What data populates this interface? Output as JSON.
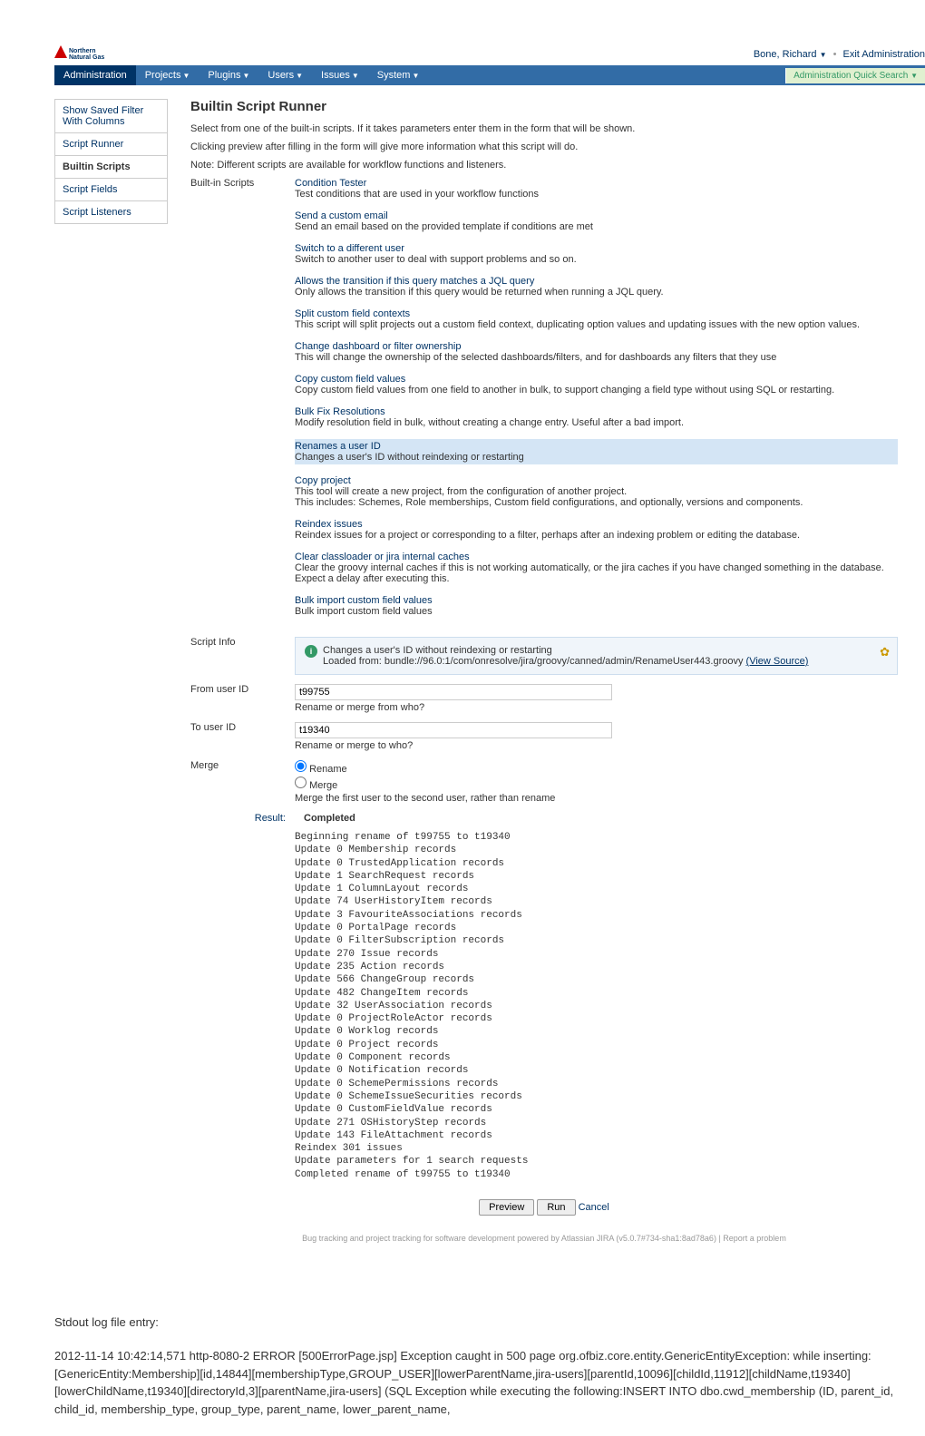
{
  "logo": {
    "line1": "Northern",
    "line2": "Natural Gas"
  },
  "user": {
    "name": "Bone, Richard",
    "exit": "Exit Administration"
  },
  "nav": {
    "items": [
      {
        "label": "Administration",
        "dd": false
      },
      {
        "label": "Projects",
        "dd": true
      },
      {
        "label": "Plugins",
        "dd": true
      },
      {
        "label": "Users",
        "dd": true
      },
      {
        "label": "Issues",
        "dd": true
      },
      {
        "label": "System",
        "dd": true
      }
    ],
    "search_placeholder": "Administration Quick Search"
  },
  "sidebar": {
    "items": [
      "Show Saved Filter With Columns",
      "Script Runner",
      "Builtin Scripts",
      "Script Fields",
      "Script Listeners"
    ]
  },
  "content": {
    "title": "Builtin Script Runner",
    "intro1": "Select from one of the built-in scripts. If it takes parameters enter them in the form that will be shown.",
    "intro2": "Clicking preview after filling in the form will give more information what this script will do.",
    "intro3": "Note: Different scripts are available for workflow functions and listeners.",
    "scripts_label": "Built-in Scripts",
    "scripts": [
      {
        "title": "Condition Tester",
        "desc": "Test conditions that are used in your workflow functions"
      },
      {
        "title": "Send a custom email",
        "desc": "Send an email based on the provided template if conditions are met"
      },
      {
        "title": "Switch to a different user",
        "desc": "Switch to another user to deal with support problems and so on."
      },
      {
        "title": "Allows the transition if this query matches a JQL query",
        "desc": "Only allows the transition if this query would be returned when running a JQL query."
      },
      {
        "title": "Split custom field contexts",
        "desc": "This script will split projects out a custom field context, duplicating option values and updating issues with the new option values."
      },
      {
        "title": "Change dashboard or filter ownership",
        "desc": "This will change the ownership of the selected dashboards/filters, and for dashboards any filters that they use"
      },
      {
        "title": "Copy custom field values",
        "desc": "Copy custom field values from one field to another in bulk, to support changing a field type without using SQL or restarting."
      },
      {
        "title": "Bulk Fix Resolutions",
        "desc": "Modify resolution field in bulk, without creating a change entry. Useful after a bad import."
      },
      {
        "title": "Renames a user ID",
        "desc": "Changes a user's ID without reindexing or restarting",
        "selected": true
      },
      {
        "title": "Copy project",
        "desc": "This tool will create a new project, from the configuration of another project.\nThis includes: Schemes, Role memberships, Custom field configurations, and optionally, versions and components."
      },
      {
        "title": "Reindex issues",
        "desc": "Reindex issues for a project or corresponding to a filter, perhaps after an indexing problem or editing the database."
      },
      {
        "title": "Clear classloader or jira internal caches",
        "desc": "Clear the groovy internal caches if this is not working automatically, or the jira caches if you have changed something in the database. Expect a delay after executing this."
      },
      {
        "title": "Bulk import custom field values",
        "desc": "Bulk import custom field values"
      }
    ],
    "script_info_label": "Script Info",
    "script_info_text": "Changes a user's ID without reindexing or restarting",
    "script_info_loaded": "Loaded from: bundle://96.0:1/com/onresolve/jira/groovy/canned/admin/RenameUser443.groovy ",
    "view_source": "(View Source)",
    "from_label": "From user ID",
    "from_value": "t99755",
    "from_hint": "Rename or merge from who?",
    "to_label": "To user ID",
    "to_value": "t19340",
    "to_hint": "Rename or merge to who?",
    "merge_label": "Merge",
    "radio_rename": "Rename",
    "radio_merge": "Merge",
    "merge_hint": "Merge the first user to the second user, rather than rename",
    "result_label": "Result:",
    "result_value": "Completed",
    "log_lines": [
      "Beginning rename of t99755 to t19340",
      "Update 0 Membership records",
      "Update 0 TrustedApplication records",
      "Update 1 SearchRequest records",
      "Update 1 ColumnLayout records",
      "Update 74 UserHistoryItem records",
      "Update 3 FavouriteAssociations records",
      "Update 0 PortalPage records",
      "Update 0 FilterSubscription records",
      "Update 270 Issue records",
      "Update 235 Action records",
      "Update 566 ChangeGroup records",
      "Update 482 ChangeItem records",
      "Update 32 UserAssociation records",
      "Update 0 ProjectRoleActor records",
      "Update 0 Worklog records",
      "Update 0 Project records",
      "Update 0 Component records",
      "Update 0 Notification records",
      "Update 0 SchemePermissions records",
      "Update 0 SchemeIssueSecurities records",
      "Update 0 CustomFieldValue records",
      "Update 271 OSHistoryStep records",
      "Update 143 FileAttachment records",
      "Reindex 301 issues",
      "Update parameters for 1 search requests",
      "Completed rename of t99755 to t19340"
    ],
    "btn_preview": "Preview",
    "btn_run": "Run",
    "btn_cancel": "Cancel",
    "footer": "Bug tracking and project tracking for software development powered by Atlassian JIRA (v5.0.7#734-sha1:8ad78a6)   |   Report a problem"
  },
  "stdout": {
    "heading": "Stdout log file entry:",
    "text": "2012-11-14 10:42:14,571 http-8080-2 ERROR      [500ErrorPage.jsp] Exception caught in 500 page org.ofbiz.core.entity.GenericEntityException: while inserting: [GenericEntity:Membership][id,14844][membershipType,GROUP_USER][lowerParentName,jira-users][parentId,10096][childId,11912][childName,t19340][lowerChildName,t19340][directoryId,3][parentName,jira-users] (SQL Exception while executing the following:INSERT INTO dbo.cwd_membership (ID, parent_id, child_id, membership_type, group_type, parent_name, lower_parent_name,"
  }
}
